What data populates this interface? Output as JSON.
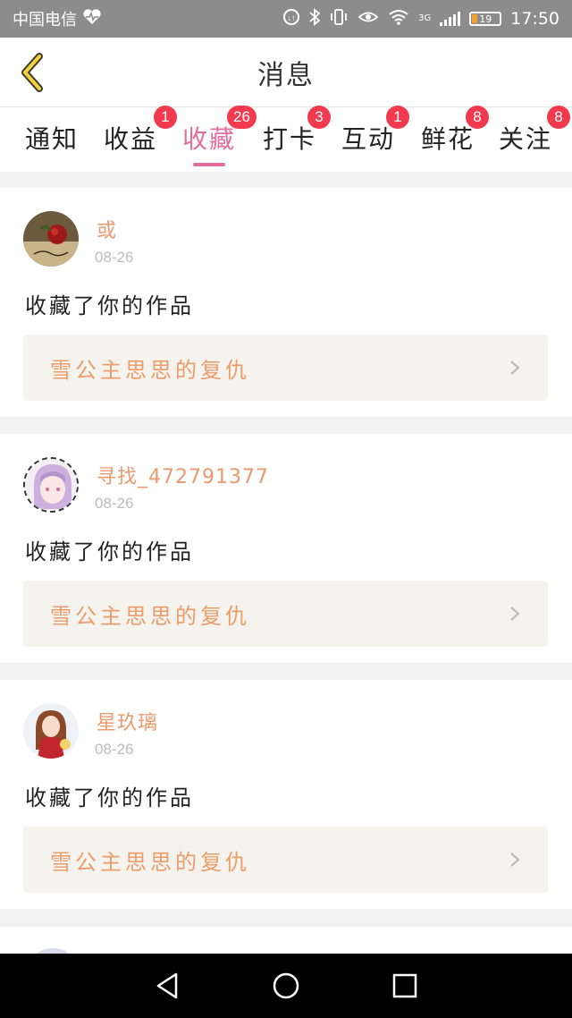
{
  "status_bar": {
    "carrier": "中国电信",
    "heart_icon": "heart-pulse-icon",
    "network": "3G",
    "battery": "19",
    "time": "17:50"
  },
  "header": {
    "title": "消息",
    "back_icon": "chevron-left-icon"
  },
  "tabs": [
    {
      "label": "通知",
      "badge": ""
    },
    {
      "label": "收益",
      "badge": "1"
    },
    {
      "label": "收藏",
      "badge": "26",
      "active": true
    },
    {
      "label": "打卡",
      "badge": "3"
    },
    {
      "label": "互动",
      "badge": "1"
    },
    {
      "label": "鲜花",
      "badge": "8"
    },
    {
      "label": "关注",
      "badge": "8"
    }
  ],
  "messages": [
    {
      "username": "或",
      "date": "08-26",
      "action": "收藏了你的作品",
      "work_title": "雪公主思思的复仇"
    },
    {
      "username": "寻找_472791377",
      "date": "08-26",
      "action": "收藏了你的作品",
      "work_title": "雪公主思思的复仇"
    },
    {
      "username": "星玖璃",
      "date": "08-26",
      "action": "收藏了你的作品",
      "work_title": "雪公主思思的复仇"
    }
  ],
  "colors": {
    "accent_pink": "#e36d9d",
    "badge_red": "#f23a4f",
    "username_orange": "#e99a6e",
    "work_title_orange": "#ec9c6a"
  }
}
